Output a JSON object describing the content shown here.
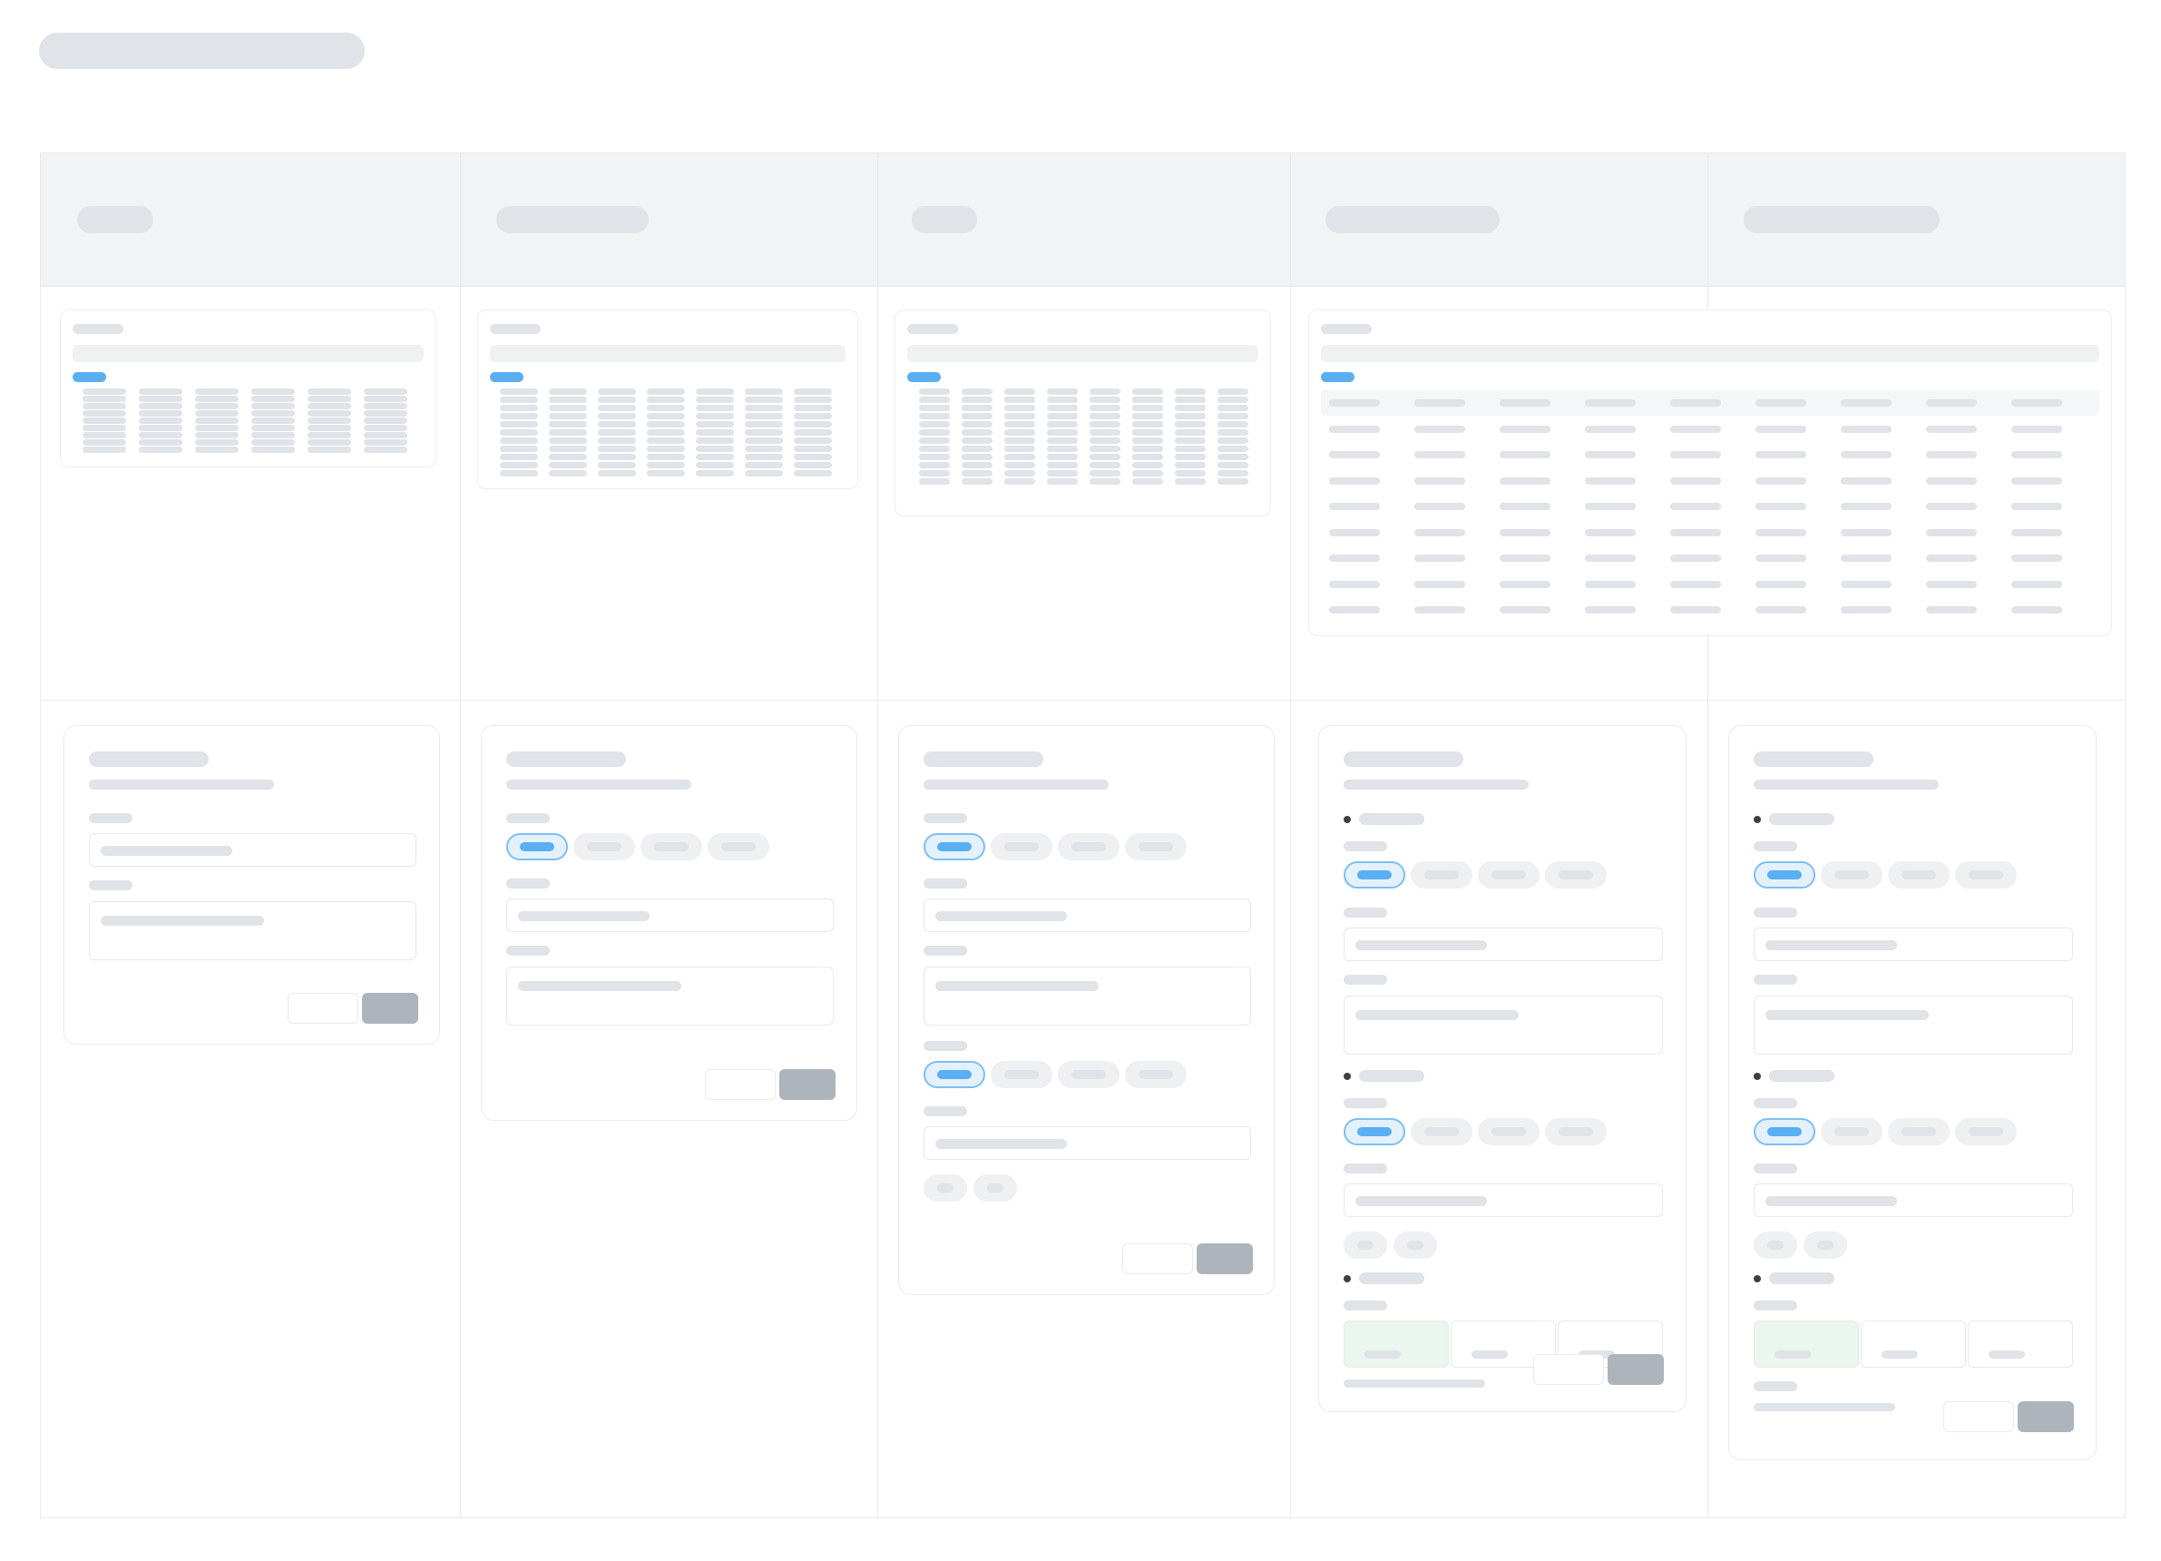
{
  "page": {
    "title": "",
    "colors": {
      "skeleton": "#e0e3e7",
      "accent": "#5aaef2",
      "button": "#aeb4bb",
      "selected_chip_bg": "#e3f1fd",
      "success_tile": "#eaf6ee",
      "header_bg": "#f2f3f5"
    }
  },
  "board": {
    "columns": [
      {
        "header": ""
      },
      {
        "header": ""
      },
      {
        "header": ""
      },
      {
        "header": ""
      },
      {
        "header": ""
      }
    ]
  }
}
